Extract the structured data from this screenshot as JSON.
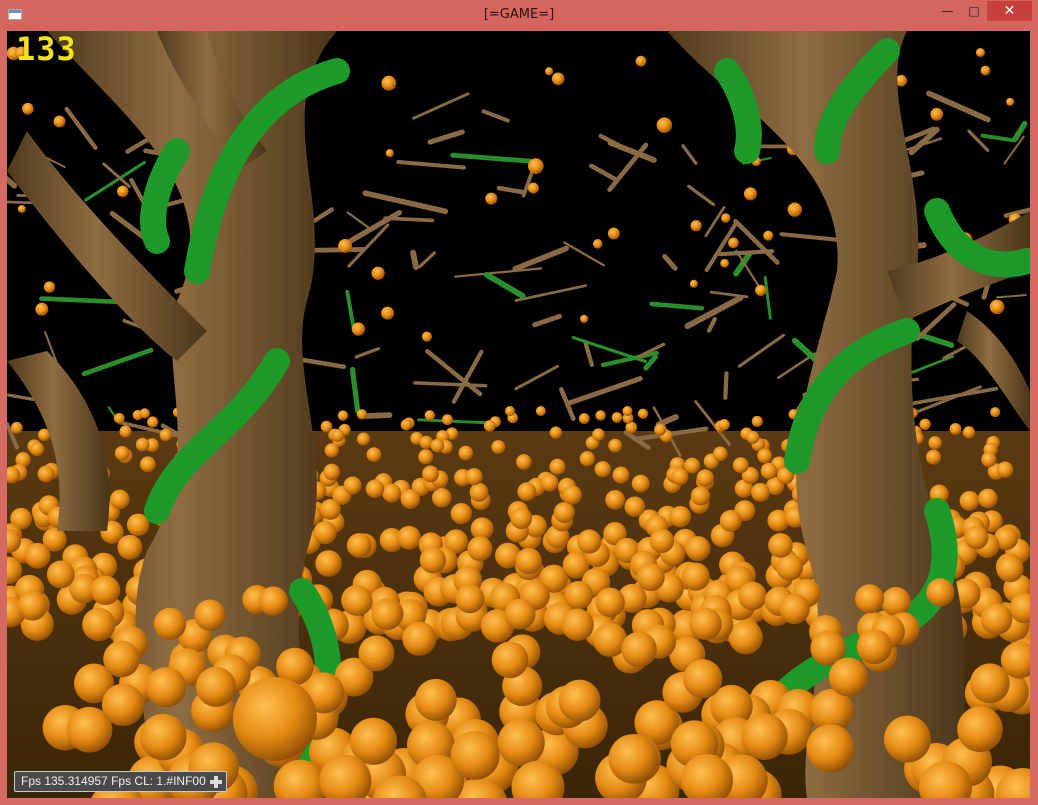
{
  "window": {
    "title": "[=GAME=]",
    "controls": {
      "minimize": "—",
      "maximize": "□",
      "close": "✕"
    }
  },
  "hud": {
    "score": "133",
    "fps_text": "Fps 135.314957 Fps CL: 1.#INF00",
    "score_color": "#f3e21a"
  },
  "scene": {
    "description_colors": {
      "trunk": "#7a5a32",
      "vine": "#1f9a2c",
      "fruit": "#e8901a",
      "sky": "#000000"
    }
  }
}
